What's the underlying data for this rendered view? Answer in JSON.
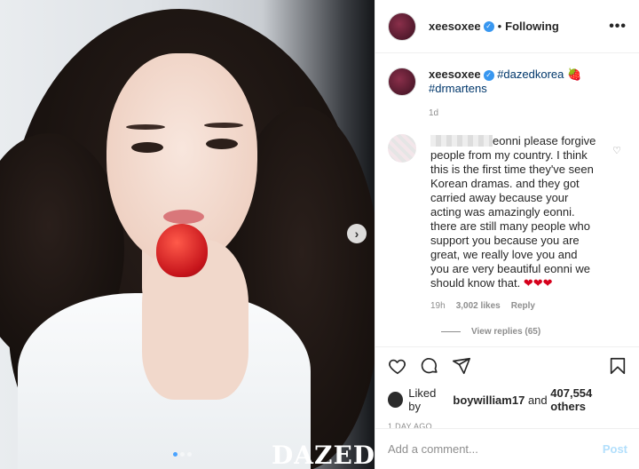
{
  "post": {
    "author": "xeesoxee",
    "follow_sep": "•",
    "follow_label": "Following",
    "more_label": "•••",
    "caption_tag1": "#dazedkorea",
    "caption_emoji": "🍓",
    "caption_tag2": "#drmartens",
    "posted_ago": "1d",
    "watermark": "DAZED",
    "carousel_dots": 3,
    "carousel_active": 1
  },
  "comment": {
    "text": "eonni please forgive people from my country. I think this is the first time they've seen Korean dramas. and they got carried away because your acting was amazingly eonni. there are still many people who support you because you are great, we really love you and you are very beautiful eonni we should know that.",
    "hearts": "❤❤❤",
    "time": "19h",
    "likes": "3,002 likes",
    "reply_label": "Reply",
    "view_replies": "View replies (65)"
  },
  "actions": {
    "liked_by_prefix": "Liked by",
    "liked_by_user": "boywilliam17",
    "liked_by_and": "and",
    "liked_by_count": "407,554 others",
    "date": "1 DAY AGO"
  },
  "composer": {
    "placeholder": "Add a comment...",
    "post_label": "Post"
  },
  "colors": {
    "verified": "#3897f0",
    "hashtag": "#00376b",
    "heart": "#d6001c",
    "post_disabled": "#b2dffc"
  }
}
